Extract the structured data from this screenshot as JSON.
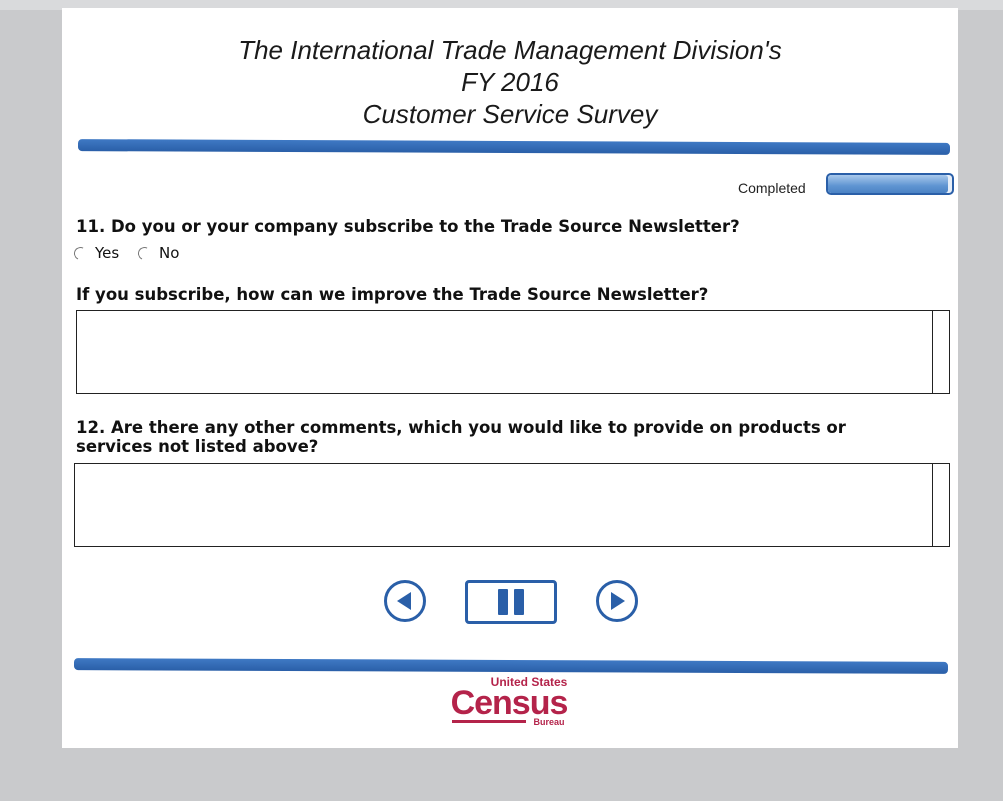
{
  "header": {
    "title_line1": "The International Trade Management Division's",
    "title_line2": "FY 2016",
    "title_line3": "Customer Service Survey"
  },
  "progress": {
    "label": "Completed",
    "fraction": 0.97
  },
  "questions": {
    "q11": {
      "text": "11. Do you or your company subscribe to the Trade Source Newsletter?",
      "options": [
        "Yes",
        "No"
      ]
    },
    "improve": {
      "text": "If you subscribe, how can we improve the Trade Source Newsletter?",
      "value": ""
    },
    "q12": {
      "text": "12. Are there any other comments, which you would like to provide on products or services not listed above?",
      "value": ""
    }
  },
  "navigation": {
    "prev_icon": "back-arrow-icon",
    "pause_icon": "pause-icon",
    "next_icon": "forward-arrow-icon"
  },
  "footer": {
    "logo_top": "United States",
    "logo_main": "Census",
    "logo_bottom": "Bureau"
  },
  "colors": {
    "accent": "#2a5fa8",
    "brand": "#b4234a"
  }
}
